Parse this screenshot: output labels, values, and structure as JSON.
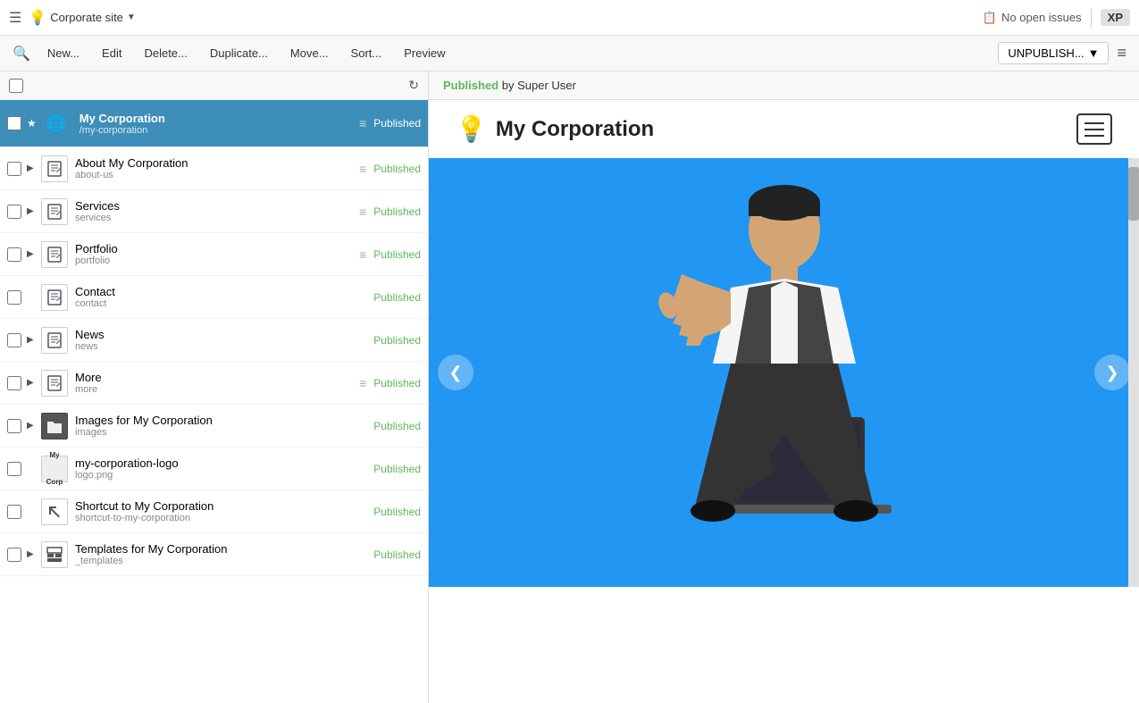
{
  "topbar": {
    "hamburger": "☰",
    "site_indicator_dot": "💡",
    "site_name": "Corporate site",
    "dropdown_arrow": "▼",
    "issues_label": "No open issues",
    "xp_label": "XP"
  },
  "toolbar": {
    "search_icon": "🔍",
    "new_label": "New...",
    "edit_label": "Edit",
    "delete_label": "Delete...",
    "duplicate_label": "Duplicate...",
    "move_label": "Move...",
    "sort_label": "Sort...",
    "preview_label": "Preview",
    "unpublish_label": "UNPUBLISH...",
    "list_view_icon": "≡"
  },
  "tree": {
    "items": [
      {
        "id": "root",
        "name": "My Corporation",
        "slug": "/my-corporation",
        "status": "Published",
        "has_expand": false,
        "has_drag": true,
        "selected": true,
        "icon_type": "globe"
      },
      {
        "id": "about",
        "name": "About My Corporation",
        "slug": "about-us",
        "status": "Published",
        "has_expand": true,
        "has_drag": true,
        "selected": false,
        "icon_type": "page"
      },
      {
        "id": "services",
        "name": "Services",
        "slug": "services",
        "status": "Published",
        "has_expand": true,
        "has_drag": true,
        "selected": false,
        "icon_type": "page"
      },
      {
        "id": "portfolio",
        "name": "Portfolio",
        "slug": "portfolio",
        "status": "Published",
        "has_expand": true,
        "has_drag": true,
        "selected": false,
        "icon_type": "page"
      },
      {
        "id": "contact",
        "name": "Contact",
        "slug": "contact",
        "status": "Published",
        "has_expand": false,
        "has_drag": false,
        "selected": false,
        "icon_type": "page"
      },
      {
        "id": "news",
        "name": "News",
        "slug": "news",
        "status": "Published",
        "has_expand": true,
        "has_drag": false,
        "selected": false,
        "icon_type": "page"
      },
      {
        "id": "more",
        "name": "More",
        "slug": "more",
        "status": "Published",
        "has_expand": true,
        "has_drag": true,
        "selected": false,
        "icon_type": "page"
      },
      {
        "id": "images",
        "name": "Images for My Corporation",
        "slug": "images",
        "status": "Published",
        "has_expand": true,
        "has_drag": false,
        "selected": false,
        "icon_type": "folder"
      },
      {
        "id": "logo",
        "name": "my-corporation-logo",
        "slug": "logo.png",
        "status": "Published",
        "has_expand": false,
        "has_drag": false,
        "selected": false,
        "icon_type": "logo"
      },
      {
        "id": "shortcut",
        "name": "Shortcut to My Corporation",
        "slug": "shortcut-to-my-corporation",
        "status": "Published",
        "has_expand": false,
        "has_drag": false,
        "selected": false,
        "icon_type": "shortcut"
      },
      {
        "id": "templates",
        "name": "Templates for My Corporation",
        "slug": "_templates",
        "status": "Published",
        "has_expand": true,
        "has_drag": false,
        "selected": false,
        "icon_type": "template"
      }
    ]
  },
  "preview": {
    "status_text": "Published",
    "status_by": "by Super User",
    "site_title": "My Corporation",
    "carousel_prev": "❮",
    "carousel_next": "❯"
  }
}
